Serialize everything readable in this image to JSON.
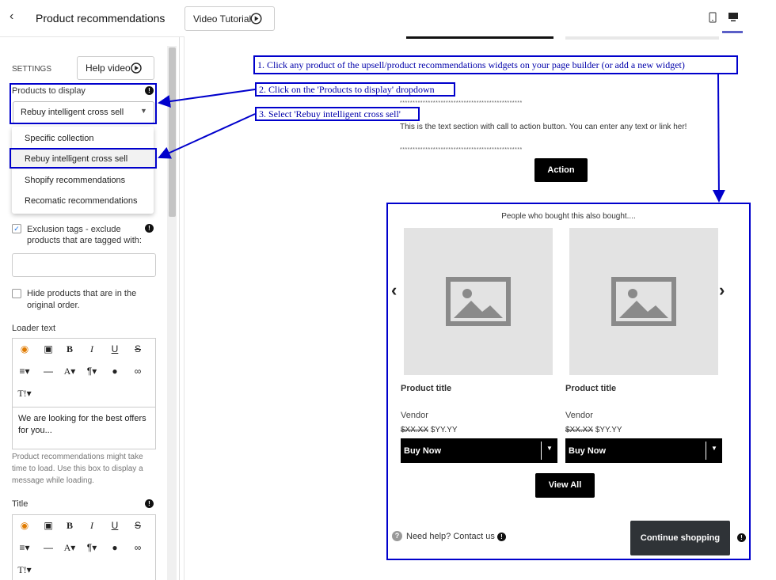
{
  "sidebar": {
    "title": "Product recommendations",
    "settings_label": "SETTINGS",
    "help_video_label": "Help video",
    "products_to_display_label": "Products to display",
    "products_to_display_value": "Rebuy intelligent cross sell",
    "dropdown_options": [
      "Specific collection",
      "Rebuy intelligent cross sell",
      "Shopify recommendations",
      "Recomatic recommendations"
    ],
    "exclusion_label": "Exclusion tags - exclude products that are tagged with:",
    "exclusion_value": "",
    "hide_products_label": "Hide products that are in the original order.",
    "loader_text_label": "Loader text",
    "loader_text_value": "We are looking for the best offers for you...",
    "loader_help": "Product recommendations might take time to load. Use this box to display a message while loading.",
    "title_label": "Title"
  },
  "topbar": {
    "video_tutorial_label": "Video Tutorial"
  },
  "annotations": {
    "step1": "1. Click any product of the upsell/product recommendations widgets on your page builder (or add a new widget)",
    "step2": "2. Click on the 'Products to display' dropdown",
    "step3": "3. Select 'Rebuy intelligent cross sell'"
  },
  "page": {
    "divider_stars": "************************************************",
    "text_section": "This is the text section with call to action button. You can enter any text or link her!",
    "action_label": "Action",
    "widget_heading": "People who bought this also bought....",
    "products": [
      {
        "title": "Product title",
        "vendor": "Vendor",
        "old_price": "$XX.XX",
        "price": "$YY.YY",
        "buy_label": "Buy Now"
      },
      {
        "title": "Product title",
        "vendor": "Vendor",
        "old_price": "$XX.XX",
        "price": "$YY.YY",
        "buy_label": "Buy Now"
      }
    ],
    "view_all_label": "View All",
    "help_text": "Need help? Contact us",
    "continue_label": "Continue shopping"
  },
  "colors": {
    "annotation": "#0000cc",
    "accent_underline": "#5b5fc7",
    "editor_icon": "#e07b00"
  }
}
